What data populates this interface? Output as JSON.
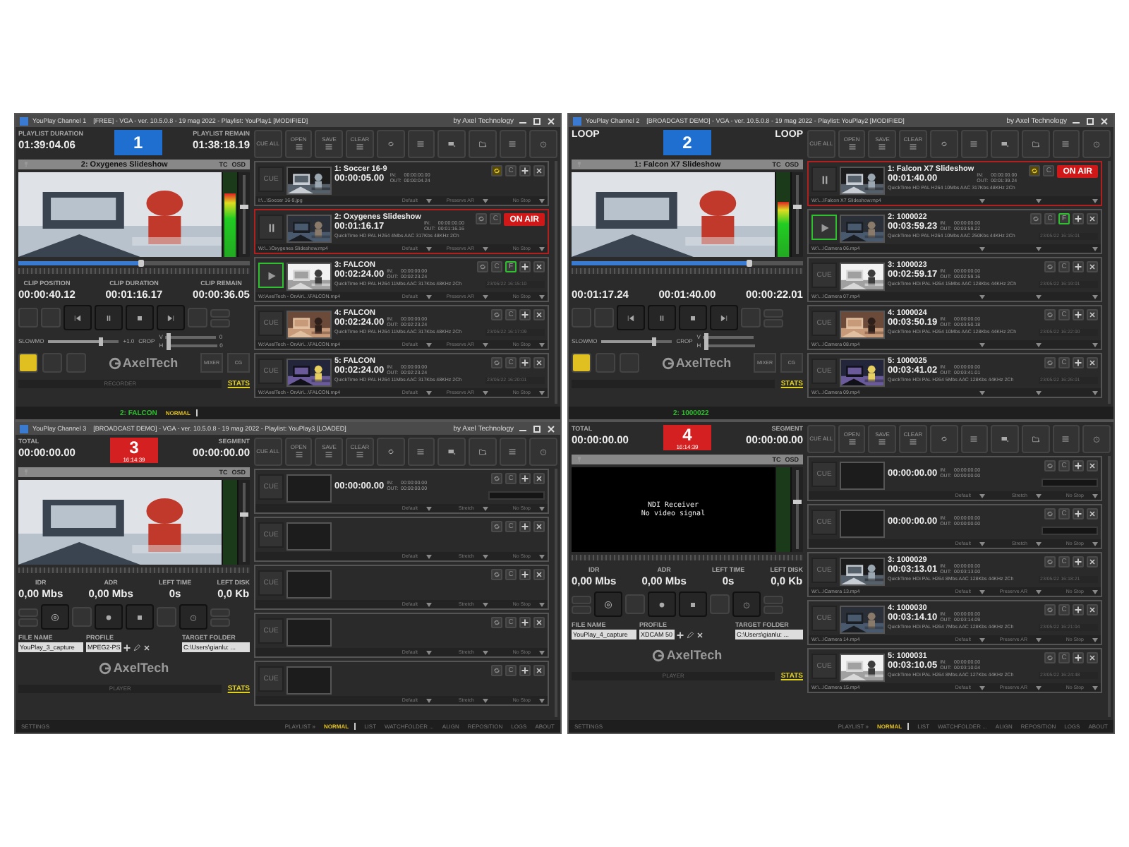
{
  "windows": [
    {
      "title": "YouPlay Channel 1    [FREE] - VGA - ver. 10.5.0.8 - 19 mag 2022 - Playlist: YouPlay1 [MODIFIED]",
      "brand": "by Axel Technology",
      "kind": "player",
      "header": {
        "left_label": "PLAYLIST DURATION",
        "left_value": "01:39:04.06",
        "right_label": "PLAYLIST REMAIN",
        "right_value": "01:38:18.19"
      },
      "badge": {
        "number": "1",
        "color": "#1e6fd0"
      },
      "preview": {
        "title": "2: Oxygenes Slideshow",
        "tc": "TC",
        "osd": "OSD",
        "kind": "picture"
      },
      "meter": {
        "level": 0.75
      },
      "volume": {
        "level": 0.62
      },
      "seek": {
        "level": 0.53
      },
      "stats": [
        {
          "label": "CLIP POSITION",
          "value": "00:00:40.12"
        },
        {
          "label": "CLIP DURATION",
          "value": "00:01:16.17"
        },
        {
          "label": "CLIP REMAIN",
          "value": "00:00:36.05"
        }
      ],
      "slowmo": {
        "label": "SLOWMO",
        "value": "+1.0",
        "level": 0.74
      },
      "crop": {
        "label": "CROP",
        "v": "V",
        "h": "H",
        "v_value": "0",
        "h_value": "0",
        "v_slider": {
          "level": 0.05
        },
        "h_slider": {
          "level": 0.05
        }
      },
      "logo": "AxelTech",
      "side_buttons": [
        "MIXER",
        "CG"
      ],
      "mode_label": "RECORDER",
      "stats_link": "STATS",
      "toolbar": [
        "CUE ALL",
        "OPEN",
        "SAVE",
        "CLEAR"
      ],
      "playlist": [
        {
          "title": "1: Soccer 16-9",
          "duration": "00:00:05.00",
          "in_label": "IN:",
          "out_label": "OUT:",
          "in": "00:00:00.00",
          "out": "00:00:04.24",
          "path": "I:\\...\\Soccer 16-9.jpg",
          "options": [
            "Default",
            "Preserve AR",
            "No Stop"
          ],
          "kind": "cue",
          "cue_label": "CUE",
          "loop": true,
          "c": "C",
          "on_air": false,
          "thumb": {
            "kind": "picture"
          }
        },
        {
          "title": "2: Oxygenes Slideshow",
          "duration": "00:01:16.17",
          "in_label": "IN:",
          "out_label": "OUT:",
          "in": "00:00:00.00",
          "out": "00:01:16.16",
          "codec": "QuickTime HD PAL  H264 4Mbs AAC 317Kbs 48KHz 2Ch",
          "path": "W:\\...\\Oxygenes Slideshow.mp4",
          "options": [
            "Default",
            "Preserve AR",
            "No Stop"
          ],
          "kind": "paused",
          "loop": false,
          "c": "C",
          "on_air": true,
          "on_air_label": "ON AIR",
          "thumb": {
            "kind": "picture"
          }
        },
        {
          "title": "3: FALCON",
          "duration": "00:02:24.00",
          "in_label": "IN:",
          "out_label": "OUT:",
          "in": "00:00:00.00",
          "out": "00:02:23.24",
          "codec": "QuickTime HD PAL  H264 11Mbs AAC 317Kbs 48KHz 2Ch",
          "path": "W:\\AxelTech - OnAir\\...\\FALCON.mp4",
          "options": [
            "Default",
            "Preserve AR",
            "No Stop"
          ],
          "kind": "playing",
          "loop": false,
          "c": "C",
          "f": "F",
          "on_air": false,
          "scheduled": "23/05/22 16:15:10",
          "thumb": {
            "kind": "picture"
          }
        },
        {
          "title": "4: FALCON",
          "duration": "00:02:24.00",
          "in_label": "IN:",
          "out_label": "OUT:",
          "in": "00:00:00.00",
          "out": "00:02:23.24",
          "codec": "QuickTime HD PAL  H264 11Mbs AAC 317Kbs 48KHz 2Ch",
          "path": "W:\\AxelTech - OnAir\\...\\FALCON.mp4",
          "options": [
            "Default",
            "Preserve AR",
            "No Stop"
          ],
          "kind": "cue",
          "cue_label": "CUE",
          "loop": false,
          "c": "C",
          "on_air": false,
          "scheduled": "23/05/22 16:17:09",
          "thumb": {
            "kind": "picture"
          }
        },
        {
          "title": "5: FALCON",
          "duration": "00:02:24.00",
          "in_label": "IN:",
          "out_label": "OUT:",
          "in": "00:00:00.00",
          "out": "00:02:23.24",
          "codec": "QuickTime HD PAL  H264 11Mbs AAC 317Kbs 48KHz 2Ch",
          "path": "W:\\AxelTech - OnAir\\...\\FALCON.mp4",
          "options": [
            "Default",
            "Preserve AR",
            "No Stop"
          ],
          "kind": "cue",
          "cue_label": "CUE",
          "loop": false,
          "c": "C",
          "on_air": false,
          "scheduled": "23/05/22 16:20:01",
          "thumb": {
            "kind": "picture"
          }
        }
      ],
      "status_bar": {
        "now_playing": "2: FALCON",
        "tabs": [
          {
            "label": "NORMAL",
            "selected": true
          }
        ]
      }
    },
    {
      "title": "YouPlay Channel 2    [BROADCAST DEMO] - VGA - ver. 10.5.0.8 - 19 mag 2022 - Playlist: YouPlay2 [MODIFIED]",
      "brand": "by Axel Technology",
      "kind": "player",
      "header": {
        "left_label": "LOOP",
        "right_label": "LOOP"
      },
      "badge": {
        "number": "2",
        "color": "#1e6fd0"
      },
      "preview": {
        "title": "1: Falcon X7 Slideshow",
        "tc": "TC",
        "osd": "OSD",
        "kind": "picture"
      },
      "meter": {
        "level": 0.65
      },
      "volume": {
        "level": 0.62
      },
      "seek": {
        "level": 0.77
      },
      "stats": [
        {
          "value": "00:01:17.24"
        },
        {
          "value": "00:01:40.00"
        },
        {
          "value": "00:00:22.01"
        }
      ],
      "slowmo": {
        "label": "SLOWMO",
        "level": 0.74
      },
      "crop": {
        "label": "CROP",
        "v": "V",
        "h": "H",
        "v_slider": {
          "level": 0.05
        },
        "h_slider": {
          "level": 0.05
        }
      },
      "logo": "AxelTech",
      "side_buttons": [
        "MIXER",
        "CG"
      ],
      "stats_link": "STATS",
      "toolbar": [
        "CUE ALL",
        "OPEN",
        "SAVE",
        "CLEAR"
      ],
      "playlist": [
        {
          "title": "1: Falcon X7 Slideshow",
          "duration": "00:01:40.00",
          "in_label": "IN:",
          "out_label": "OUT:",
          "in": "00:00:00.00",
          "out": "00:01:39.24",
          "codec": "QuickTime HD PAL  H264 10Mbs AAC 317Kbs 48KHz 2Ch",
          "path": "W:\\...\\Falcon X7 Slideshow.mp4",
          "kind": "paused",
          "loop": true,
          "c": "C",
          "on_air": true,
          "on_air_label": "ON AIR",
          "thumb": {
            "kind": "picture"
          }
        },
        {
          "title": "2: 1000022",
          "duration": "00:03:59.23",
          "in_label": "IN:",
          "out_label": "OUT:",
          "in": "00:00:00.00",
          "out": "00:03:59.22",
          "codec": "QuickTime HD PAL  H264 10Mbs AAC 250Kbs 44KHz 2Ch",
          "path": "W:\\...\\Camera 06.mp4",
          "kind": "playing",
          "loop": false,
          "c": "C",
          "f": "F",
          "on_air": false,
          "scheduled": "23/05/22 16:15:01",
          "thumb": {
            "kind": "picture"
          }
        },
        {
          "title": "3: 1000023",
          "duration": "00:02:59.17",
          "in_label": "IN:",
          "out_label": "OUT:",
          "in": "00:00:00.00",
          "out": "00:02:59.16",
          "codec": "QuickTime HDi PAL  H264 15Mbs AAC 128Kbs 44KHz 2Ch",
          "path": "W:\\...\\Camera 07.mp4",
          "kind": "cue",
          "cue_label": "CUE",
          "loop": false,
          "c": "C",
          "on_air": false,
          "scheduled": "23/05/22 16:19:01",
          "thumb": {
            "kind": "picture"
          }
        },
        {
          "title": "4: 1000024",
          "duration": "00:03:50.19",
          "in_label": "IN:",
          "out_label": "OUT:",
          "in": "00:00:00.00",
          "out": "00:03:50.18",
          "codec": "QuickTime HDi PAL  H264 10Mbs AAC 128Kbs 44KHz 2Ch",
          "path": "W:\\...\\Camera 08.mp4",
          "kind": "cue",
          "cue_label": "CUE",
          "loop": false,
          "c": "C",
          "on_air": false,
          "scheduled": "23/05/22 16:22:00",
          "thumb": {
            "kind": "picture"
          }
        },
        {
          "title": "5: 1000025",
          "duration": "00:03:41.02",
          "in_label": "IN:",
          "out_label": "OUT:",
          "in": "00:00:00.00",
          "out": "00:03:41.01",
          "codec": "QuickTime HDi PAL  H264 5Mbs AAC 128Kbs 44KHz 2Ch",
          "path": "W:\\...\\Camera 09.mp4",
          "kind": "cue",
          "cue_label": "CUE",
          "loop": false,
          "c": "C",
          "on_air": false,
          "scheduled": "23/05/22 16:26:01",
          "thumb": {
            "kind": "picture"
          }
        }
      ],
      "status_bar": {
        "now_playing": "2: 1000022"
      }
    },
    {
      "title": "YouPlay Channel 3    [BROADCAST DEMO] - VGA - ver. 10.5.0.8 - 19 mag 2022 - Playlist: YouPlay3 [LOADED]",
      "brand": "by Axel Technology",
      "kind": "recorder",
      "header": {
        "left_label": "TOTAL",
        "left_value": "00:00:00.00",
        "right_label": "SEGMENT",
        "right_value": "00:00:00.00"
      },
      "badge": {
        "number": "3",
        "clock": "16:14:39",
        "color": "#d42020"
      },
      "preview": {
        "tc": "TC",
        "osd": "OSD",
        "kind": "picture"
      },
      "volume": {
        "level": 0.62
      },
      "stats": [
        {
          "label": "IDR",
          "value": "0,00 Mbs"
        },
        {
          "label": "ADR",
          "value": "0,00 Mbs"
        },
        {
          "label": "LEFT TIME",
          "value": "0s"
        },
        {
          "label": "LEFT DISK",
          "value": "0,0 Kb"
        }
      ],
      "form": {
        "file_label": "FILE NAME",
        "file": "YouPlay_3_capture",
        "profile_label": "PROFILE",
        "profile": "MPEG2-PS",
        "folder_label": "TARGET FOLDER",
        "folder": "C:\\Users\\gianlu: ..."
      },
      "logo": "AxelTech",
      "mode_label": "PLAYER",
      "stats_link": "STATS",
      "toolbar": [
        "CUE ALL",
        "OPEN",
        "SAVE",
        "CLEAR"
      ],
      "playlist": [
        {
          "duration": "00:00:00.00",
          "in_label": "IN:",
          "out_label": "OUT:",
          "in": "00:00:00.00",
          "out": "00:00:00.00",
          "options": [
            "Default",
            "Stretch",
            "No Stop"
          ],
          "kind": "cue",
          "cue_label": "CUE",
          "loop": false,
          "c": "C",
          "on_air": false,
          "schedule_box": true
        },
        {
          "options": [
            "Default",
            "Stretch",
            "No Stop"
          ],
          "kind": "cue",
          "cue_label": "CUE",
          "loop": false,
          "c": "C",
          "on_air": false
        },
        {
          "options": [
            "Default",
            "Stretch",
            "No Stop"
          ],
          "kind": "cue",
          "cue_label": "CUE",
          "loop": false,
          "c": "C",
          "on_air": false
        },
        {
          "options": [
            "Default",
            "Stretch",
            "No Stop"
          ],
          "kind": "cue",
          "cue_label": "CUE",
          "loop": false,
          "c": "C",
          "on_air": false
        },
        {
          "options": [
            "Default",
            "Stretch",
            "No Stop"
          ],
          "kind": "cue",
          "cue_label": "CUE",
          "loop": false,
          "c": "C",
          "on_air": false
        }
      ],
      "status_bar": {
        "left": "SETTINGS",
        "tabs": [
          {
            "label": "PLAYLIST »",
            "selected": false
          },
          {
            "label": "NORMAL",
            "selected": true
          },
          {
            "label": "LIST",
            "selected": false
          },
          {
            "label": "WATCHFOLDER ...",
            "selected": false
          },
          {
            "label": "ALIGN",
            "selected": false
          },
          {
            "label": "REPOSITION",
            "selected": false
          },
          {
            "label": "LOGS",
            "selected": false
          },
          {
            "label": "ABOUT",
            "selected": false
          }
        ]
      }
    },
    {
      "kind": "recorder",
      "header": {
        "left_label": "TOTAL",
        "left_value": "00:00:00.00",
        "right_label": "SEGMENT",
        "right_value": "00:00:00.00"
      },
      "badge": {
        "number": "4",
        "clock": "16:14:39",
        "color": "#d42020"
      },
      "preview": {
        "tc": "TC",
        "osd": "OSD",
        "kind": "signal",
        "lines": [
          "NDI Receiver",
          "No video signal"
        ]
      },
      "volume": {
        "level": 0.62
      },
      "stats": [
        {
          "label": "IDR",
          "value": "0,00 Mbs"
        },
        {
          "label": "ADR",
          "value": "0,00 Mbs"
        },
        {
          "label": "LEFT TIME",
          "value": "0s"
        },
        {
          "label": "LEFT DISK",
          "value": "0,0 Kb"
        }
      ],
      "form": {
        "file_label": "FILE NAME",
        "file": "YouPlay_4_capture",
        "profile_label": "PROFILE",
        "profile": "XDCAM 50",
        "folder_label": "TARGET FOLDER",
        "folder": "C:\\Users\\gianlu: ..."
      },
      "logo": "AxelTech",
      "mode_label": "PLAYER",
      "stats_link": "STATS",
      "toolbar": [
        "CUE ALL",
        "OPEN",
        "SAVE",
        "CLEAR"
      ],
      "playlist": [
        {
          "duration": "00:00:00.00",
          "in_label": "IN:",
          "out_label": "OUT:",
          "in": "00:00:00.00",
          "out": "00:00:00.00",
          "options": [
            "Default",
            "Stretch",
            "No Stop"
          ],
          "kind": "cue",
          "cue_label": "CUE",
          "loop": false,
          "c": "C",
          "on_air": false,
          "schedule_box": true
        },
        {
          "duration": "00:00:00.00",
          "in_label": "IN:",
          "out_label": "OUT:",
          "in": "00:00:00.00",
          "out": "00:00:00.00",
          "options": [
            "Default",
            "Stretch",
            "No Stop"
          ],
          "kind": "cue",
          "cue_label": "CUE",
          "loop": false,
          "c": "C",
          "on_air": false,
          "schedule_box": true
        },
        {
          "title": "3: 1000029",
          "duration": "00:03:13.01",
          "in_label": "IN:",
          "out_label": "OUT:",
          "in": "00:00:00.00",
          "out": "00:03:13.00",
          "codec": "QuickTime HDi PAL  H264 8Mbs AAC 128Kbs 44KHz 2Ch",
          "path": "W:\\...\\Camera 13.mp4",
          "options": [
            "Default",
            "Preserve AR",
            "No Stop"
          ],
          "kind": "cue",
          "cue_label": "CUE",
          "loop": false,
          "c": "C",
          "on_air": false,
          "scheduled": "23/05/22 16:18:21",
          "thumb": {
            "kind": "picture"
          }
        },
        {
          "title": "4: 1000030",
          "duration": "00:03:14.10",
          "in_label": "IN:",
          "out_label": "OUT:",
          "in": "00:00:00.00",
          "out": "00:03:14.09",
          "codec": "QuickTime HDi PAL  H264 7Mbs AAC 128Kbs 44KHz 2Ch",
          "path": "W:\\...\\Camera 14.mp4",
          "options": [
            "Default",
            "Preserve AR",
            "No Stop"
          ],
          "kind": "cue",
          "cue_label": "CUE",
          "loop": false,
          "c": "C",
          "on_air": false,
          "scheduled": "23/05/22 16:21:04",
          "thumb": {
            "kind": "picture"
          }
        },
        {
          "title": "5: 1000031",
          "duration": "00:03:10.05",
          "in_label": "IN:",
          "out_label": "OUT:",
          "in": "00:00:00.00",
          "out": "00:03:10.04",
          "codec": "QuickTime HDi PAL  H264 8Mbs AAC 127Kbs 44KHz 2Ch",
          "path": "W:\\...\\Camera 15.mp4",
          "options": [
            "Default",
            "Preserve AR",
            "No Stop"
          ],
          "kind": "cue",
          "cue_label": "CUE",
          "loop": false,
          "c": "C",
          "on_air": false,
          "scheduled": "23/05/22 16:24:48",
          "thumb": {
            "kind": "picture"
          }
        }
      ],
      "status_bar": {
        "left": "SETTINGS",
        "tabs": [
          {
            "label": "PLAYLIST »",
            "selected": false
          },
          {
            "label": "NORMAL",
            "selected": true
          },
          {
            "label": "LIST",
            "selected": false
          },
          {
            "label": "WATCHFOLDER ...",
            "selected": false
          },
          {
            "label": "ALIGN",
            "selected": false
          },
          {
            "label": "REPOSITION",
            "selected": false
          },
          {
            "label": "LOGS",
            "selected": false
          },
          {
            "label": "ABOUT",
            "selected": false
          }
        ]
      }
    }
  ]
}
